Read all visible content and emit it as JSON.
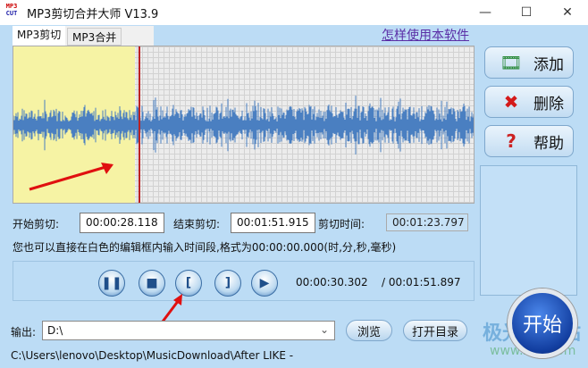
{
  "window": {
    "title": "MP3剪切合并大师 V13.9",
    "logo_text": [
      "MP3",
      "CUT"
    ]
  },
  "tabs": [
    {
      "label": "MP3剪切",
      "active": true
    },
    {
      "label": "MP3合并",
      "active": false
    }
  ],
  "howto_link": "怎样使用本软件",
  "side_buttons": [
    {
      "label": "添加",
      "icon": "add-file-icon"
    },
    {
      "label": "删除",
      "icon": "delete-x-icon"
    },
    {
      "label": "帮助",
      "icon": "help-icon"
    }
  ],
  "cut": {
    "start_label": "开始剪切:",
    "start_value": "00:00:28.118",
    "end_label": "结束剪切:",
    "end_value": "00:01:51.915",
    "duration_label": "剪切时间:",
    "duration_value": "00:01:23.797",
    "hint": "您也可以直接在白色的编辑框内输入时间段,格式为00:00:00.000(时,分,秒,毫秒)"
  },
  "player": {
    "current": "00:00:30.302",
    "total": "/ 00:01:51.897",
    "selection_fraction": 0.26
  },
  "output": {
    "label": "输出:",
    "value": "D:\\",
    "browse": "浏览",
    "open_dir": "打开目录",
    "path": "C:\\Users\\lenovo\\Desktop\\MusicDownload\\After LIKE -"
  },
  "start_button": "开始",
  "watermark": {
    "name": "极光下载站",
    "url": "www.xz7.com"
  },
  "colors": {
    "background": "#bcdcf5",
    "wave": "#4a7fc1",
    "selection": "#f6f3a4",
    "cursor": "#b22222"
  }
}
